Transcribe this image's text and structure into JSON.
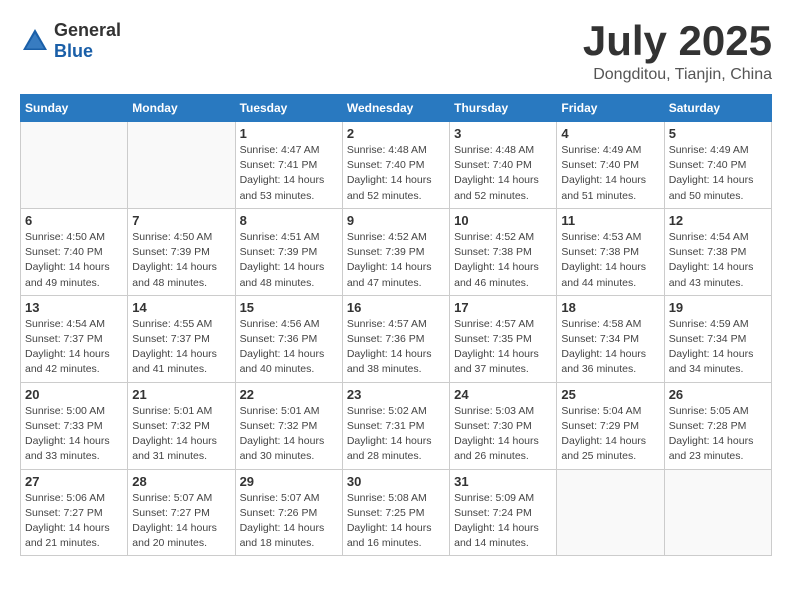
{
  "header": {
    "logo_general": "General",
    "logo_blue": "Blue",
    "month_title": "July 2025",
    "location": "Dongditou, Tianjin, China"
  },
  "calendar": {
    "days_of_week": [
      "Sunday",
      "Monday",
      "Tuesday",
      "Wednesday",
      "Thursday",
      "Friday",
      "Saturday"
    ],
    "weeks": [
      [
        {
          "day": "",
          "info": ""
        },
        {
          "day": "",
          "info": ""
        },
        {
          "day": "1",
          "info": "Sunrise: 4:47 AM\nSunset: 7:41 PM\nDaylight: 14 hours and 53 minutes."
        },
        {
          "day": "2",
          "info": "Sunrise: 4:48 AM\nSunset: 7:40 PM\nDaylight: 14 hours and 52 minutes."
        },
        {
          "day": "3",
          "info": "Sunrise: 4:48 AM\nSunset: 7:40 PM\nDaylight: 14 hours and 52 minutes."
        },
        {
          "day": "4",
          "info": "Sunrise: 4:49 AM\nSunset: 7:40 PM\nDaylight: 14 hours and 51 minutes."
        },
        {
          "day": "5",
          "info": "Sunrise: 4:49 AM\nSunset: 7:40 PM\nDaylight: 14 hours and 50 minutes."
        }
      ],
      [
        {
          "day": "6",
          "info": "Sunrise: 4:50 AM\nSunset: 7:40 PM\nDaylight: 14 hours and 49 minutes."
        },
        {
          "day": "7",
          "info": "Sunrise: 4:50 AM\nSunset: 7:39 PM\nDaylight: 14 hours and 48 minutes."
        },
        {
          "day": "8",
          "info": "Sunrise: 4:51 AM\nSunset: 7:39 PM\nDaylight: 14 hours and 48 minutes."
        },
        {
          "day": "9",
          "info": "Sunrise: 4:52 AM\nSunset: 7:39 PM\nDaylight: 14 hours and 47 minutes."
        },
        {
          "day": "10",
          "info": "Sunrise: 4:52 AM\nSunset: 7:38 PM\nDaylight: 14 hours and 46 minutes."
        },
        {
          "day": "11",
          "info": "Sunrise: 4:53 AM\nSunset: 7:38 PM\nDaylight: 14 hours and 44 minutes."
        },
        {
          "day": "12",
          "info": "Sunrise: 4:54 AM\nSunset: 7:38 PM\nDaylight: 14 hours and 43 minutes."
        }
      ],
      [
        {
          "day": "13",
          "info": "Sunrise: 4:54 AM\nSunset: 7:37 PM\nDaylight: 14 hours and 42 minutes."
        },
        {
          "day": "14",
          "info": "Sunrise: 4:55 AM\nSunset: 7:37 PM\nDaylight: 14 hours and 41 minutes."
        },
        {
          "day": "15",
          "info": "Sunrise: 4:56 AM\nSunset: 7:36 PM\nDaylight: 14 hours and 40 minutes."
        },
        {
          "day": "16",
          "info": "Sunrise: 4:57 AM\nSunset: 7:36 PM\nDaylight: 14 hours and 38 minutes."
        },
        {
          "day": "17",
          "info": "Sunrise: 4:57 AM\nSunset: 7:35 PM\nDaylight: 14 hours and 37 minutes."
        },
        {
          "day": "18",
          "info": "Sunrise: 4:58 AM\nSunset: 7:34 PM\nDaylight: 14 hours and 36 minutes."
        },
        {
          "day": "19",
          "info": "Sunrise: 4:59 AM\nSunset: 7:34 PM\nDaylight: 14 hours and 34 minutes."
        }
      ],
      [
        {
          "day": "20",
          "info": "Sunrise: 5:00 AM\nSunset: 7:33 PM\nDaylight: 14 hours and 33 minutes."
        },
        {
          "day": "21",
          "info": "Sunrise: 5:01 AM\nSunset: 7:32 PM\nDaylight: 14 hours and 31 minutes."
        },
        {
          "day": "22",
          "info": "Sunrise: 5:01 AM\nSunset: 7:32 PM\nDaylight: 14 hours and 30 minutes."
        },
        {
          "day": "23",
          "info": "Sunrise: 5:02 AM\nSunset: 7:31 PM\nDaylight: 14 hours and 28 minutes."
        },
        {
          "day": "24",
          "info": "Sunrise: 5:03 AM\nSunset: 7:30 PM\nDaylight: 14 hours and 26 minutes."
        },
        {
          "day": "25",
          "info": "Sunrise: 5:04 AM\nSunset: 7:29 PM\nDaylight: 14 hours and 25 minutes."
        },
        {
          "day": "26",
          "info": "Sunrise: 5:05 AM\nSunset: 7:28 PM\nDaylight: 14 hours and 23 minutes."
        }
      ],
      [
        {
          "day": "27",
          "info": "Sunrise: 5:06 AM\nSunset: 7:27 PM\nDaylight: 14 hours and 21 minutes."
        },
        {
          "day": "28",
          "info": "Sunrise: 5:07 AM\nSunset: 7:27 PM\nDaylight: 14 hours and 20 minutes."
        },
        {
          "day": "29",
          "info": "Sunrise: 5:07 AM\nSunset: 7:26 PM\nDaylight: 14 hours and 18 minutes."
        },
        {
          "day": "30",
          "info": "Sunrise: 5:08 AM\nSunset: 7:25 PM\nDaylight: 14 hours and 16 minutes."
        },
        {
          "day": "31",
          "info": "Sunrise: 5:09 AM\nSunset: 7:24 PM\nDaylight: 14 hours and 14 minutes."
        },
        {
          "day": "",
          "info": ""
        },
        {
          "day": "",
          "info": ""
        }
      ]
    ]
  }
}
